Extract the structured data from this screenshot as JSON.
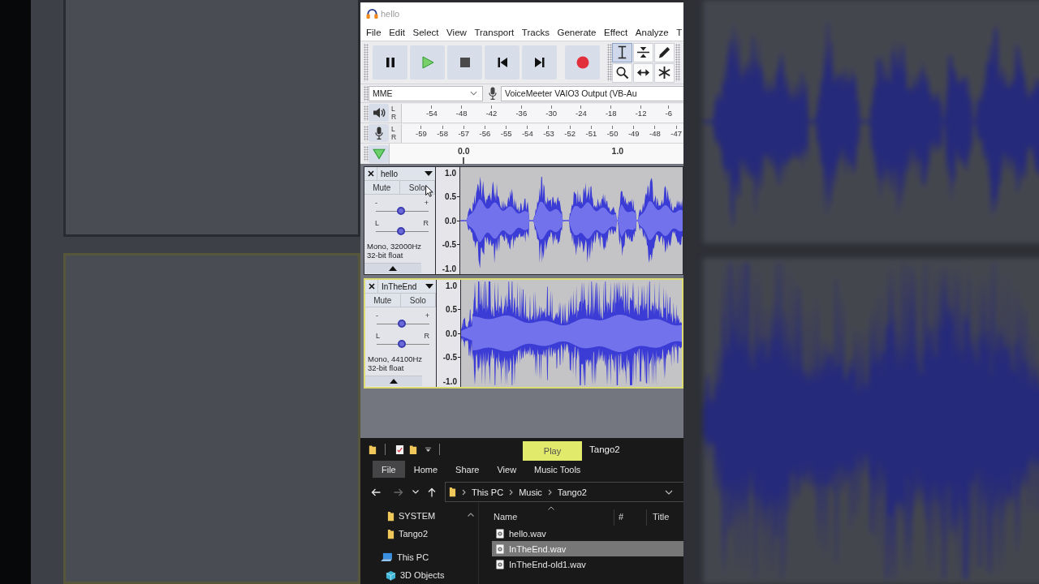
{
  "audacity": {
    "window": {
      "title": "hello"
    },
    "menu": [
      "File",
      "Edit",
      "Select",
      "View",
      "Transport",
      "Tracks",
      "Generate",
      "Effect",
      "Analyze",
      "T"
    ],
    "tools": [
      {
        "selected": true
      },
      {
        "selected": false
      },
      {
        "selected": false
      },
      {
        "selected": false
      },
      {
        "selected": false
      },
      {
        "selected": false
      }
    ],
    "device_bar": {
      "host": "MME",
      "recording_device": "VoiceMeeter VAIO3 Output (VB-Au"
    },
    "playback_meter": {
      "channels": [
        "L",
        "R"
      ],
      "scale": [
        "-54",
        "-48",
        "-42",
        "-36",
        "-30",
        "-24",
        "-18",
        "-12",
        "-6"
      ]
    },
    "recording_meter": {
      "channels": [
        "L",
        "R"
      ],
      "scale": [
        "-59",
        "-58",
        "-57",
        "-56",
        "-55",
        "-54",
        "-53",
        "-52",
        "-51",
        "-50",
        "-49",
        "-48",
        "-47"
      ]
    },
    "timeline": {
      "ticks": [
        "0.0",
        "1.0"
      ]
    },
    "tracks": [
      {
        "name": "hello",
        "selected": false,
        "mute": "Mute",
        "solo": "Solo",
        "gain": {
          "min": "-",
          "max": "+",
          "level": 0.48
        },
        "pan": {
          "left": "L",
          "right": "R",
          "level": 0.48
        },
        "format": [
          "Mono, 32000Hz",
          "32-bit float"
        ],
        "ruler": [
          "1.0",
          "0.5",
          "0.0",
          "-0.5",
          "-1.0"
        ]
      },
      {
        "name": "InTheEnd",
        "selected": true,
        "mute": "Mute",
        "solo": "Solo",
        "gain": {
          "min": "-",
          "max": "+",
          "level": 0.48
        },
        "pan": {
          "left": "L",
          "right": "R",
          "level": 0.48
        },
        "format": [
          "Mono, 44100Hz",
          "32-bit float"
        ],
        "ruler": [
          "1.0",
          "0.5",
          "0.0",
          "-0.5",
          "-1.0"
        ]
      }
    ]
  },
  "explorer": {
    "title": "Tango2",
    "context_tab": "Play",
    "ribbon_tabs": [
      {
        "label": "File",
        "selected": true
      },
      {
        "label": "Home",
        "selected": false
      },
      {
        "label": "Share",
        "selected": false
      },
      {
        "label": "View",
        "selected": false
      },
      {
        "label": "Music Tools",
        "selected": false
      }
    ],
    "path": [
      "This PC",
      "Music",
      "Tango2"
    ],
    "nav_pane": [
      {
        "label": "SYSTEM",
        "kind": "folder"
      },
      {
        "label": "Tango2",
        "kind": "folder"
      },
      {
        "label": "This PC",
        "kind": "computer",
        "children": [
          {
            "label": "3D Objects",
            "kind": "objects3d"
          }
        ]
      }
    ],
    "columns": [
      "Name",
      "#",
      "Title"
    ],
    "files": [
      {
        "name": "hello.wav",
        "selected": false
      },
      {
        "name": "InTheEnd.wav",
        "selected": true
      },
      {
        "name": "InTheEnd-old1.wav",
        "selected": false
      }
    ]
  }
}
